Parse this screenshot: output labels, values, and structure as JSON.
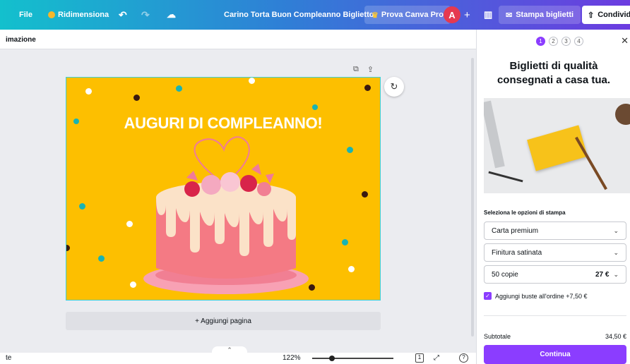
{
  "topbar": {
    "file_label": "File",
    "resize_label": "Ridimensiona",
    "title": "Carino Torta Buon Compleanno Biglietto",
    "trial_label": "Prova Canva Pro",
    "avatar_initial": "A",
    "plus": "+",
    "print_label": "Stampa biglietti",
    "share_label": "Condividi"
  },
  "subbar": {
    "label": "imazione"
  },
  "design": {
    "headline": "AUGURI DI COMPLEANNO!",
    "background": "#fdbf00",
    "add_page_label": "+ Aggiungi pagina"
  },
  "bottombar": {
    "left_label": "te",
    "zoom": "122%",
    "pages": "1",
    "help": "?"
  },
  "panel": {
    "steps": [
      "1",
      "2",
      "3",
      "4"
    ],
    "title_line1": "Biglietti di qualità",
    "title_line2": "consegnati a casa tua.",
    "section_label": "Seleziona le opzioni di stampa",
    "paper": "Carta premium",
    "finish": "Finitura satinata",
    "quantity": "50 copie",
    "quantity_price": "27 €",
    "envelope_label": "Aggiungi buste all'ordine +7,50 €",
    "subtotal_label": "Subtotale",
    "subtotal_value": "34,50 €",
    "continue_label": "Continua"
  },
  "colors": {
    "accent": "#8b3dff",
    "design_yellow": "#fdbf00",
    "selection": "#3ad0dc"
  }
}
